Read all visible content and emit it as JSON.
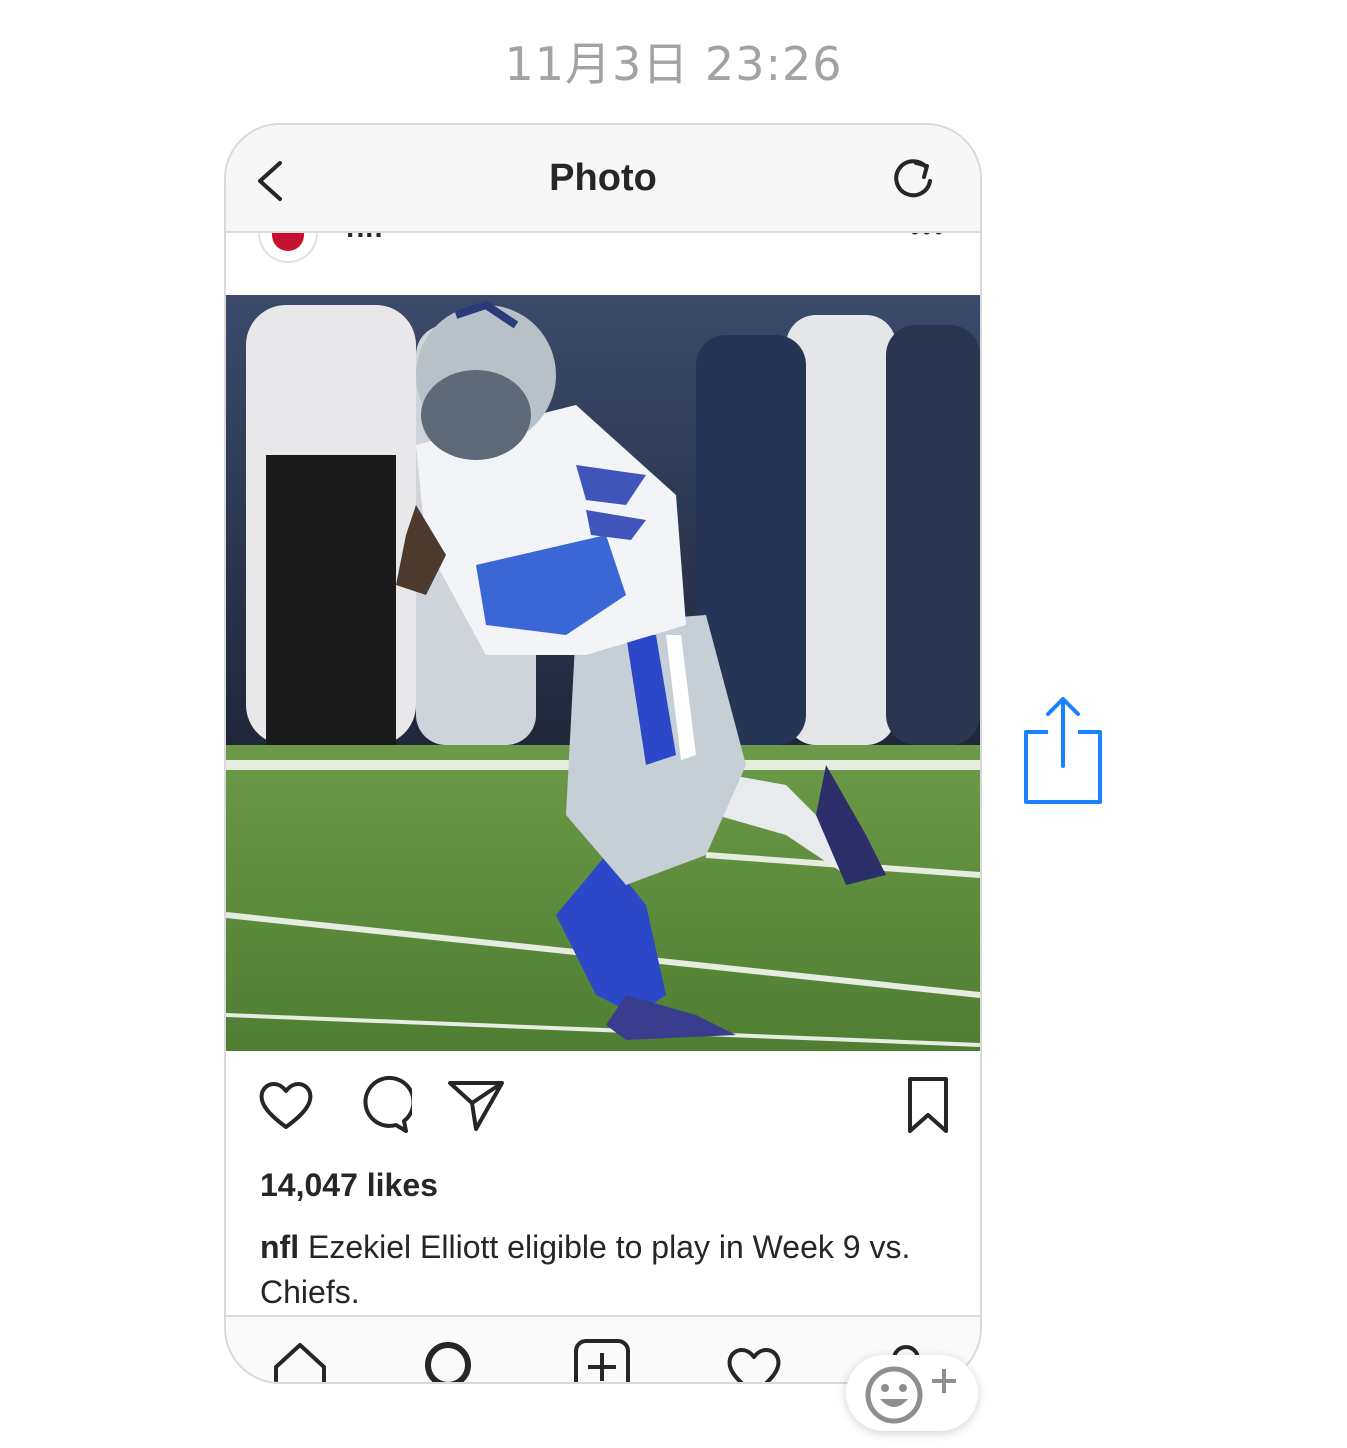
{
  "timestamp": "11月3日 23:26",
  "viewer": {
    "title": "Photo",
    "back_icon": "chevron-left-icon",
    "refresh_icon": "refresh-icon"
  },
  "post": {
    "username": "nfl",
    "likes": "14,047 likes",
    "caption_user": "nfl",
    "caption_text": " Ezekiel Elliott eligible to play in Week 9 vs. Chiefs."
  },
  "actions": [
    "heart-icon",
    "comment-icon",
    "send-icon",
    "bookmark-icon"
  ],
  "tabbar": [
    "home-icon",
    "search-icon",
    "add-icon",
    "activity-icon",
    "profile-icon"
  ],
  "colors": {
    "share_blue": "#1a82fb",
    "timestamp_gray": "#a3a3a3",
    "text_dark": "#262626"
  }
}
